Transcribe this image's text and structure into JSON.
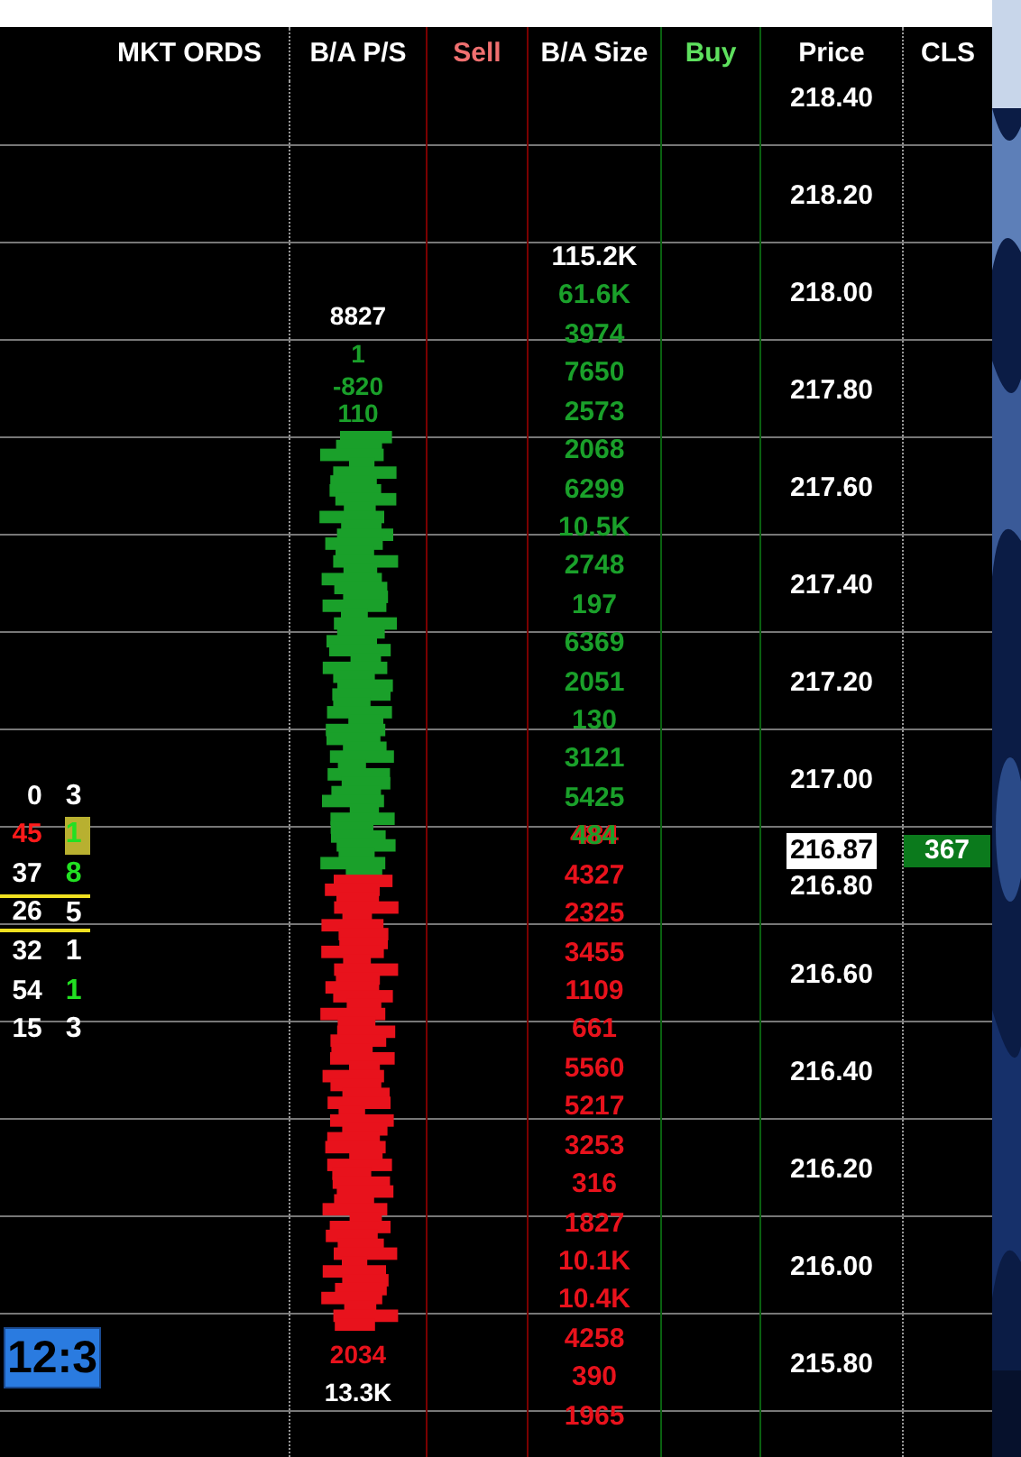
{
  "columns": [
    {
      "label": "MKT ORDS",
      "kind": "plain"
    },
    {
      "label": "B/A P/S",
      "kind": "plain"
    },
    {
      "label": "Sell",
      "kind": "sell"
    },
    {
      "label": "B/A Size",
      "kind": "plain"
    },
    {
      "label": "Buy",
      "kind": "buy"
    },
    {
      "label": "Price",
      "kind": "plain"
    },
    {
      "label": "CLS",
      "kind": "plain"
    }
  ],
  "mkt_orders": {
    "rows": [
      {
        "left": {
          "text": "0",
          "color": "#ffffff"
        },
        "right": {
          "text": "3",
          "color": "#ffffff",
          "highlighted": false
        },
        "marked": false
      },
      {
        "left": {
          "text": "45",
          "color": "#ff1a1a"
        },
        "right": {
          "text": "1",
          "color": "#22e022",
          "highlighted": true
        },
        "marked": false
      },
      {
        "left": {
          "text": "37",
          "color": "#ffffff"
        },
        "right": {
          "text": "8",
          "color": "#22e022",
          "highlighted": false
        },
        "marked": false
      },
      {
        "left": {
          "text": "26",
          "color": "#ffffff"
        },
        "right": {
          "text": "5",
          "color": "#ffffff",
          "highlighted": false
        },
        "marked": true
      },
      {
        "left": {
          "text": "32",
          "color": "#ffffff"
        },
        "right": {
          "text": "1",
          "color": "#ffffff",
          "highlighted": false
        },
        "marked": false
      },
      {
        "left": {
          "text": "54",
          "color": "#ffffff"
        },
        "right": {
          "text": "1",
          "color": "#22e022",
          "highlighted": false
        },
        "marked": false
      },
      {
        "left": {
          "text": "15",
          "color": "#ffffff"
        },
        "right": {
          "text": "3",
          "color": "#ffffff",
          "highlighted": false
        },
        "marked": false
      }
    ],
    "timer": "12:3"
  },
  "ba_ps": {
    "top": [
      {
        "texts": [
          "8827"
        ],
        "kind": "total"
      },
      {
        "texts": [
          "1"
        ],
        "kind": "bid"
      },
      {
        "texts": [
          "-820",
          "110"
        ],
        "kind": "bid"
      }
    ],
    "bottom": [
      {
        "texts": [
          "2034"
        ],
        "kind": "ask"
      },
      {
        "texts": [
          "13.3K"
        ],
        "kind": "total"
      }
    ]
  },
  "sizes": [
    {
      "text": "115.2K",
      "kind": "total"
    },
    {
      "text": "61.6K",
      "kind": "bid"
    },
    {
      "text": "3974",
      "kind": "bid"
    },
    {
      "text": "7650",
      "kind": "bid"
    },
    {
      "text": "2573",
      "kind": "bid"
    },
    {
      "text": "2068",
      "kind": "bid"
    },
    {
      "text": "6299",
      "kind": "bid"
    },
    {
      "text": "10.5K",
      "kind": "bid"
    },
    {
      "text": "2748",
      "kind": "bid"
    },
    {
      "text": "197",
      "kind": "bid"
    },
    {
      "text": "6369",
      "kind": "bid"
    },
    {
      "text": "2051",
      "kind": "bid"
    },
    {
      "text": "130",
      "kind": "bid"
    },
    {
      "text": "3121",
      "kind": "bid"
    },
    {
      "text": "5425",
      "kind": "bid"
    },
    {
      "text": "484",
      "kind": "mixed"
    },
    {
      "text": "4327",
      "kind": "ask"
    },
    {
      "text": "2325",
      "kind": "ask"
    },
    {
      "text": "3455",
      "kind": "ask"
    },
    {
      "text": "1109",
      "kind": "ask"
    },
    {
      "text": "661",
      "kind": "ask"
    },
    {
      "text": "5560",
      "kind": "ask"
    },
    {
      "text": "5217",
      "kind": "ask"
    },
    {
      "text": "3253",
      "kind": "ask"
    },
    {
      "text": "316",
      "kind": "ask"
    },
    {
      "text": "1827",
      "kind": "ask"
    },
    {
      "text": "10.1K",
      "kind": "ask"
    },
    {
      "text": "10.4K",
      "kind": "ask"
    },
    {
      "text": "4258",
      "kind": "ask"
    },
    {
      "text": "390",
      "kind": "ask"
    },
    {
      "text": "1965",
      "kind": "ask"
    }
  ],
  "prices": [
    {
      "price": "218.40",
      "kind": "level"
    },
    {
      "price": "218.20",
      "kind": "level"
    },
    {
      "price": "218.00",
      "kind": "level"
    },
    {
      "price": "217.80",
      "kind": "level"
    },
    {
      "price": "217.60",
      "kind": "level"
    },
    {
      "price": "217.40",
      "kind": "level"
    },
    {
      "price": "217.20",
      "kind": "level"
    },
    {
      "price": "217.00",
      "kind": "level"
    },
    {
      "price": "216.87",
      "kind": "last",
      "cls": "367"
    },
    {
      "price": "216.80",
      "kind": "level"
    },
    {
      "price": "216.60",
      "kind": "level"
    },
    {
      "price": "216.40",
      "kind": "level"
    },
    {
      "price": "216.20",
      "kind": "level"
    },
    {
      "price": "216.00",
      "kind": "level"
    },
    {
      "price": "215.80",
      "kind": "level"
    }
  ]
}
